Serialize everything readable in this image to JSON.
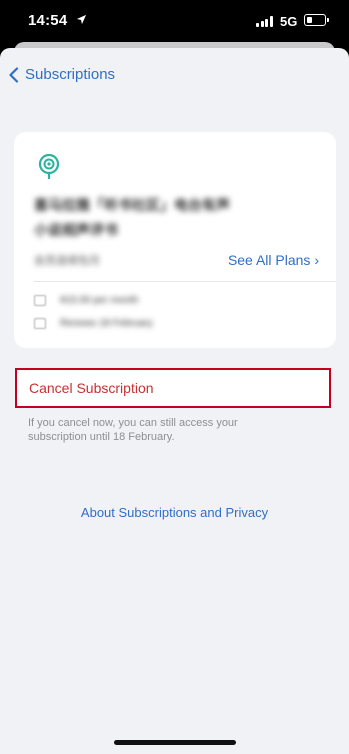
{
  "status_bar": {
    "time": "14:54",
    "network": "5G"
  },
  "nav": {
    "back_label": "Subscriptions"
  },
  "card": {
    "title_line1": "喜马拉雅「听书社区」电台有声",
    "title_line2": "小说相声评书",
    "subtitle": "会员连续包月",
    "see_all_label": "See All Plans",
    "price_text": "¥15.00 per month",
    "renews_text": "Renews 18 February"
  },
  "cancel": {
    "label": "Cancel Subscription",
    "notice": "If you cancel now, you can still access your subscription until 18 February."
  },
  "about_link": "About Subscriptions and Privacy",
  "colors": {
    "accent": "#2f6fc4",
    "destructive": "#c93030",
    "highlight_border": "#c3001f",
    "app_icon": "#2bb3a0"
  }
}
